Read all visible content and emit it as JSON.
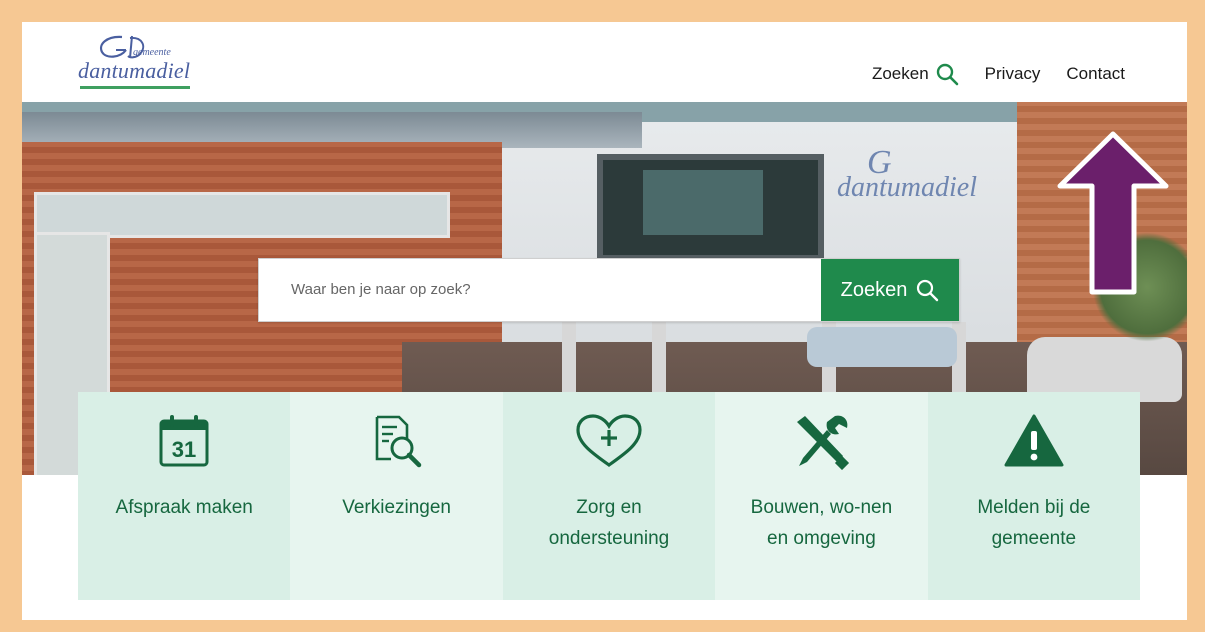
{
  "header": {
    "logo": {
      "small_text": "gemeente",
      "name": "dantumadiel"
    },
    "nav": [
      {
        "label": "Zoeken",
        "icon": "search-icon"
      },
      {
        "label": "Privacy"
      },
      {
        "label": "Contact"
      }
    ]
  },
  "hero": {
    "wall_sign": "dantumadiel",
    "search": {
      "placeholder": "Waar ben je naar op zoek?",
      "value": "",
      "button_label": "Zoeken",
      "button_icon": "search-icon"
    }
  },
  "tiles": [
    {
      "label": "Afspraak maken",
      "icon": "calendar-icon",
      "icon_text": "31"
    },
    {
      "label": "Verkiezingen",
      "icon": "document-search-icon"
    },
    {
      "label": "Zorg en ondersteuning",
      "icon": "heart-plus-icon"
    },
    {
      "label": "Bouwen, wo-nen en omgeving",
      "icon": "tools-icon"
    },
    {
      "label": "Melden bij de gemeente",
      "icon": "warning-icon"
    }
  ],
  "annotation": {
    "icon": "up-arrow-icon",
    "color": "#6b1f6b"
  },
  "colors": {
    "brand_green": "#1f8a4c",
    "tile_text": "#16673f",
    "frame": "#f6c893",
    "logo_blue": "#4a5fa0"
  }
}
